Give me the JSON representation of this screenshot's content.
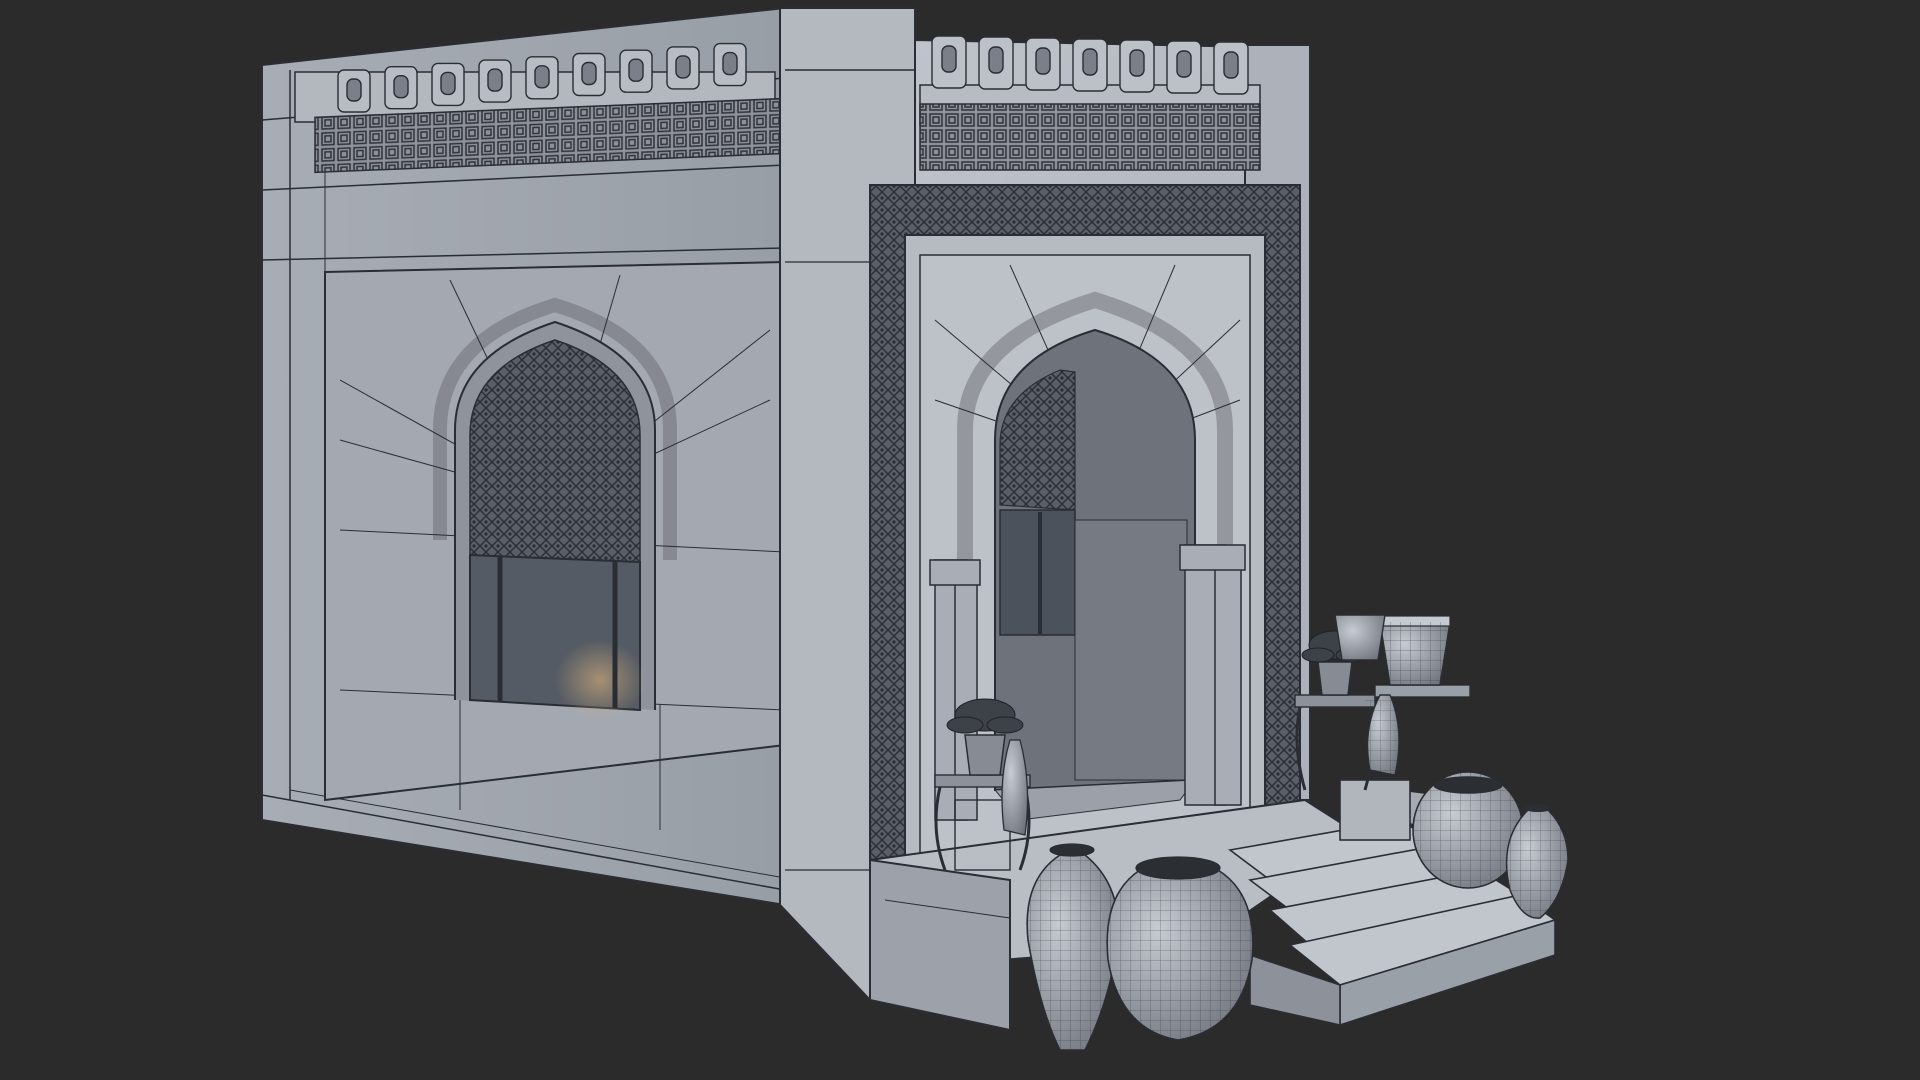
{
  "scene": {
    "background_color": "#2b2b2b",
    "stone_light": "#b9bdc4",
    "stone_mid": "#9fa4ac",
    "stone_dark": "#6e737b",
    "shadow": "#3d4148",
    "wire": "#2a2d33",
    "glass": "#4e545d",
    "subject": "moorish-pavilion-wireframe-render"
  }
}
